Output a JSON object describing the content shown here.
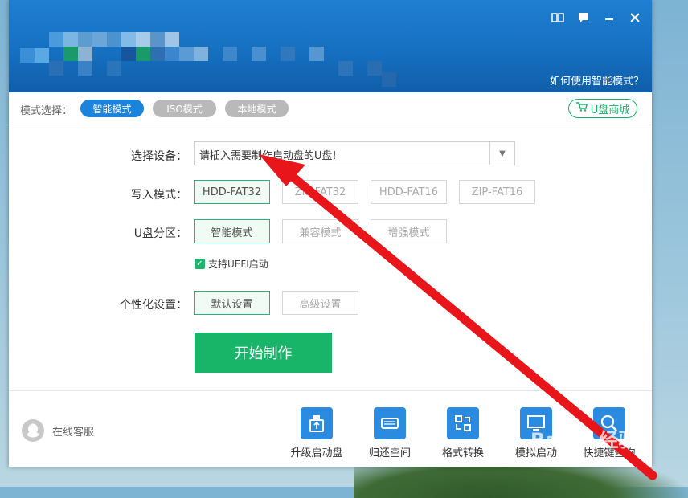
{
  "header": {
    "howto_link": "如何使用智能模式？"
  },
  "mode_bar": {
    "label": "模式选择：",
    "modes": [
      "智能模式",
      "ISO模式",
      "本地模式"
    ],
    "shop_label": "U盘商城"
  },
  "form": {
    "device_label": "选择设备：",
    "device_value": "请插入需要制作启动盘的U盘!",
    "write_label": "写入模式：",
    "write_options": [
      "HDD-FAT32",
      "ZIP-FAT32",
      "HDD-FAT16",
      "ZIP-FAT16"
    ],
    "partition_label": "U盘分区：",
    "partition_options": [
      "智能模式",
      "兼容模式",
      "增强模式"
    ],
    "uefi_label": "支持UEFI启动",
    "uefi_checked": true,
    "personal_label": "个性化设置：",
    "personal_options": [
      "默认设置",
      "高级设置"
    ],
    "start_button": "开始制作"
  },
  "footer": {
    "service": "在线客服",
    "tools": [
      "升级启动盘",
      "归还空间",
      "格式转换",
      "模拟启动",
      "快捷键查询"
    ]
  },
  "colors": {
    "header_blue": "#1670c2",
    "accent_green": "#18b569",
    "arrow_red": "#e8161b"
  },
  "watermark": "Baidu 经验"
}
